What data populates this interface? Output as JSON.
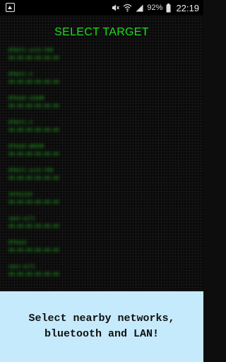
{
  "status_bar": {
    "battery_percent": "92%",
    "time": "22:19",
    "icons": [
      "notification-icon",
      "mute-icon",
      "wifi-icon",
      "signal-icon",
      "battery-icon"
    ]
  },
  "screen": {
    "title": "SELECT TARGET",
    "networks": [
      {
        "name": "BTWiFi-with-FON",
        "mac": "00:00:00:00:00:00"
      },
      {
        "name": "BTWiFi-X",
        "mac": "00:00:00:00:00:00"
      },
      {
        "name": "BTHub5-ACB4M",
        "mac": "00:00:00:00:00:00"
      },
      {
        "name": "BTWiFi-X",
        "mac": "00:00:00:00:00:00"
      },
      {
        "name": "BTHub5-WH99R",
        "mac": "00:00:00:00:00:00"
      },
      {
        "name": "BTWiFi-with-FON",
        "mac": "00:00:00:00:00:00"
      },
      {
        "name": "SKY01234",
        "mac": "00:00:00:00:00:00"
      },
      {
        "name": "open-wifi",
        "mac": "00:00:00:00:00:00"
      },
      {
        "name": "BTHub3",
        "mac": "00:00:00:00:00:00"
      },
      {
        "name": "open-wifi",
        "mac": "00:00:00:00:00:00"
      }
    ]
  },
  "caption": "Select nearby networks,\nbluetooth and LAN!",
  "colors": {
    "title": "#19e019",
    "list_text": "#1fbf1f",
    "caption_bg": "#c5eafb"
  }
}
